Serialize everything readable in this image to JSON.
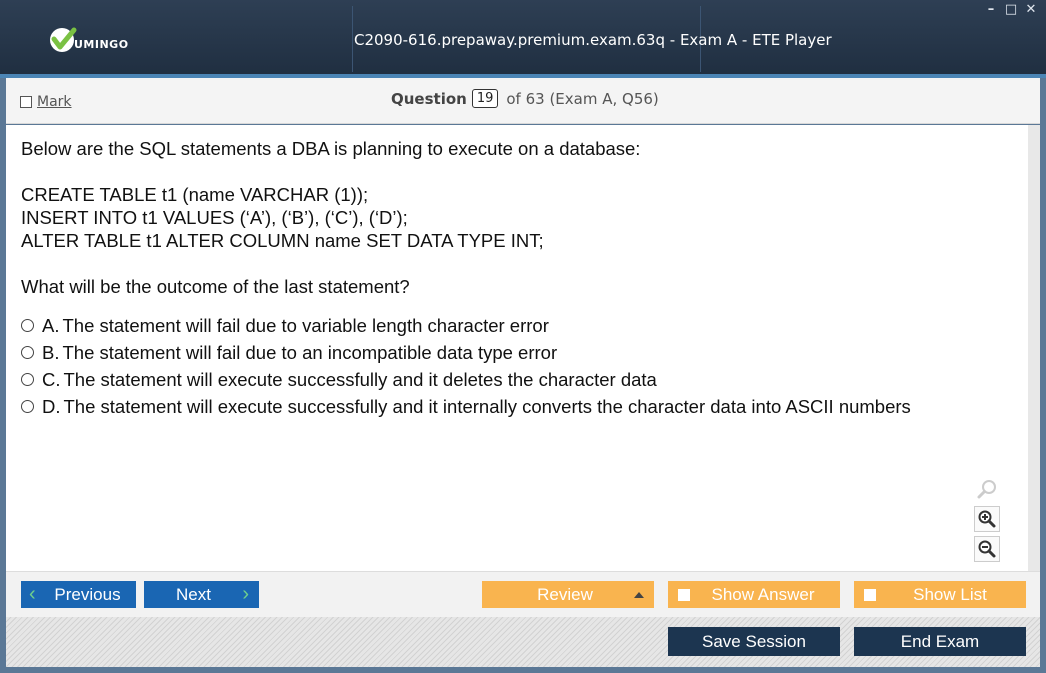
{
  "app": {
    "logo_text": "UMINGO",
    "window_title": "C2090-616.prepaway.premium.exam.63q - Exam A - ETE Player",
    "controls": {
      "minimize": "–",
      "maximize": "□",
      "close": "✕"
    }
  },
  "header": {
    "mark_label": "Mark",
    "question_label": "Question",
    "question_number": "19",
    "question_suffix": "of 63 (Exam A, Q56)"
  },
  "question": {
    "intro": "Below are the SQL statements a DBA is planning to execute on a database:",
    "code_lines": [
      "CREATE TABLE t1 (name VARCHAR (1));",
      "INSERT INTO t1 VALUES (‘A’), (‘B’), (‘C’), (‘D’);",
      "ALTER TABLE t1 ALTER COLUMN name SET DATA TYPE INT;"
    ],
    "prompt": "What will be the outcome of the last statement?",
    "options": [
      {
        "letter": "A.",
        "text": "The statement will fail due to variable length character error"
      },
      {
        "letter": "B.",
        "text": "The statement will fail due to an incompatible data type error"
      },
      {
        "letter": "C.",
        "text": "The statement will execute successfully and it deletes the character data"
      },
      {
        "letter": "D.",
        "text": "The statement will execute successfully and it internally converts the character data into ASCII numbers"
      }
    ]
  },
  "zoom": {
    "icons": [
      "magnifier-icon",
      "zoom-in-icon",
      "zoom-out-icon"
    ]
  },
  "nav": {
    "previous_label": "Previous",
    "next_label": "Next",
    "review_label": "Review",
    "show_answer_label": "Show Answer",
    "show_list_label": "Show List",
    "save_session_label": "Save Session",
    "end_exam_label": "End Exam"
  },
  "colors": {
    "titlebar": "#1f2e40",
    "primary_button": "#1a66b3",
    "accent_button": "#f9b44f",
    "dark_button": "#1c3550",
    "logo_check": "#7ac143"
  }
}
